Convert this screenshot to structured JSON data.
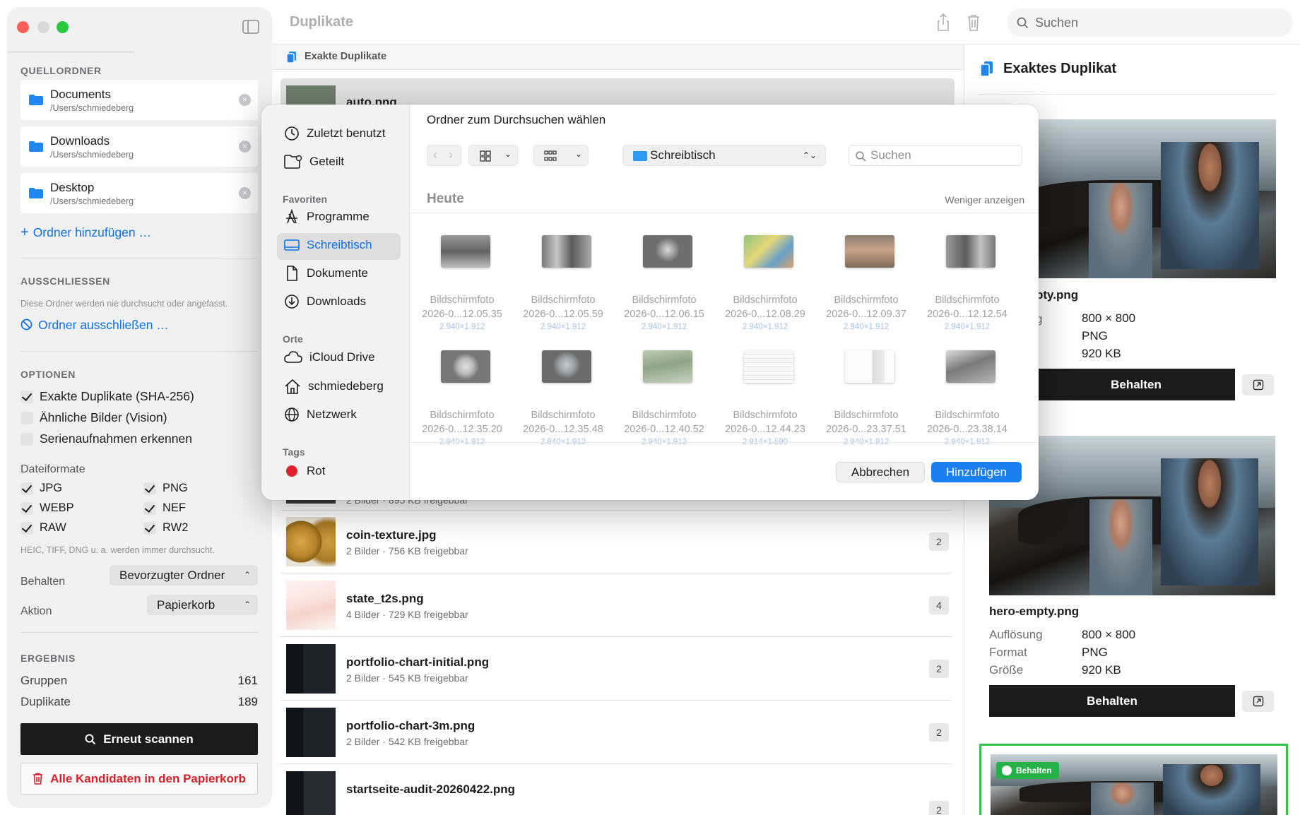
{
  "window": {
    "title": "Duplikate"
  },
  "toolbar": {
    "search_placeholder": "Suchen"
  },
  "sidebar": {
    "source_title": "QUELLORDNER",
    "sources": [
      {
        "name": "Documents",
        "path": "/Users/schmiedeberg"
      },
      {
        "name": "Downloads",
        "path": "/Users/schmiedeberg"
      },
      {
        "name": "Desktop",
        "path": "/Users/schmiedeberg"
      }
    ],
    "add_folder": "Ordner hinzufügen …",
    "exclude_title": "AUSSCHLIESSEN",
    "exclude_hint": "Diese Ordner werden nie durchsucht oder angefasst.",
    "exclude_link": "Ordner ausschließen …",
    "options_title": "OPTIONEN",
    "options": [
      {
        "label": "Exakte Duplikate (SHA-256)",
        "checked": true
      },
      {
        "label": "Ähnliche Bilder (Vision)",
        "checked": false
      },
      {
        "label": "Serienaufnahmen erkennen",
        "checked": false
      }
    ],
    "formats_title": "Dateiformate",
    "formats": [
      {
        "label": "JPG",
        "checked": true
      },
      {
        "label": "PNG",
        "checked": true
      },
      {
        "label": "WEBP",
        "checked": true
      },
      {
        "label": "NEF",
        "checked": true
      },
      {
        "label": "RAW",
        "checked": true
      },
      {
        "label": "RW2",
        "checked": true
      }
    ],
    "formats_hint": "HEIC, TIFF, DNG u. a. werden immer durchsucht.",
    "keep_label": "Behalten",
    "keep_value": "Bevorzugter Ordner",
    "action_label": "Aktion",
    "action_value": "Papierkorb",
    "result_title": "ERGEBNIS",
    "groups_label": "Gruppen",
    "groups_value": "161",
    "dups_label": "Duplikate",
    "dups_value": "189",
    "rescan": "Erneut scannen",
    "trash_all": "Alle Kandidaten in den Papierkorb"
  },
  "list": {
    "header": "Exakte Duplikate",
    "selected_name": "auto.png",
    "partial_sub": "2 Bilder · 895 KB freigebbar",
    "rows": [
      {
        "name": "coin-texture.jpg",
        "sub": "2 Bilder · 756 KB freigebbar",
        "count": "2"
      },
      {
        "name": "state_t2s.png",
        "sub": "4 Bilder · 729 KB freigebbar",
        "count": "4"
      },
      {
        "name": "portfolio-chart-initial.png",
        "sub": "2 Bilder · 545 KB freigebbar",
        "count": "2"
      },
      {
        "name": "portfolio-chart-3m.png",
        "sub": "2 Bilder · 542 KB freigebbar",
        "count": "2"
      },
      {
        "name": "startseite-audit-20260422.png",
        "sub": "",
        "count": "2"
      }
    ]
  },
  "detail": {
    "title": "Exaktes Duplikat",
    "card1": {
      "name_partial": "pty.png",
      "res": "800 × 800",
      "format": "PNG",
      "size": "920 KB",
      "label_partial": "g",
      "keep": "Behalten"
    },
    "card2": {
      "name": "hero-empty.png",
      "res_label": "Auflösung",
      "res": "800 × 800",
      "format_label": "Format",
      "format": "PNG",
      "size_label": "Größe",
      "size": "920 KB",
      "keep": "Behalten"
    },
    "card3": {
      "badge": "Behalten"
    }
  },
  "dialog": {
    "title": "Ordner zum Durchsuchen wählen",
    "sidebar": {
      "recent": "Zuletzt benutzt",
      "shared": "Geteilt",
      "favorites_title": "Favoriten",
      "favorites": [
        "Programme",
        "Schreibtisch",
        "Dokumente",
        "Downloads"
      ],
      "places_title": "Orte",
      "places": [
        "iCloud Drive",
        "schmiedeberg",
        "Netzwerk"
      ],
      "tags_title": "Tags",
      "tags": [
        "Rot"
      ]
    },
    "location": "Schreibtisch",
    "search_placeholder": "Suchen",
    "section": "Heute",
    "show_less": "Weniger anzeigen",
    "files": [
      {
        "n1": "Bildschirmfoto",
        "n2": "2026-0...12.05.35",
        "dim": "2.940×1.912"
      },
      {
        "n1": "Bildschirmfoto",
        "n2": "2026-0...12.05.59",
        "dim": "2.940×1.912"
      },
      {
        "n1": "Bildschirmfoto",
        "n2": "2026-0...12.06.15",
        "dim": "2.940×1.912"
      },
      {
        "n1": "Bildschirmfoto",
        "n2": "2026-0...12.08.29",
        "dim": "2.940×1.912"
      },
      {
        "n1": "Bildschirmfoto",
        "n2": "2026-0...12.09.37",
        "dim": "2.940×1.912"
      },
      {
        "n1": "Bildschirmfoto",
        "n2": "2026-0...12.12.54",
        "dim": "2.940×1.912"
      },
      {
        "n1": "Bildschirmfoto",
        "n2": "2026-0...12.35.20",
        "dim": "2.940×1.912"
      },
      {
        "n1": "Bildschirmfoto",
        "n2": "2026-0...12.35.48",
        "dim": "2.940×1.912"
      },
      {
        "n1": "Bildschirmfoto",
        "n2": "2026-0...12.40.52",
        "dim": "2.940×1.912"
      },
      {
        "n1": "Bildschirmfoto",
        "n2": "2026-0...12.44.23",
        "dim": "2.914×1.590"
      },
      {
        "n1": "Bildschirmfoto",
        "n2": "2026-0...23.37.51",
        "dim": "2.940×1.912"
      },
      {
        "n1": "Bildschirmfoto",
        "n2": "2026-0...23.38.14",
        "dim": "2.940×1.912"
      }
    ],
    "cancel": "Abbrechen",
    "add": "Hinzufügen"
  },
  "colors": {
    "accent": "#1a7ff0",
    "danger": "#d8202a",
    "keep_green": "#27b148",
    "tag_red": "#e0202a"
  }
}
